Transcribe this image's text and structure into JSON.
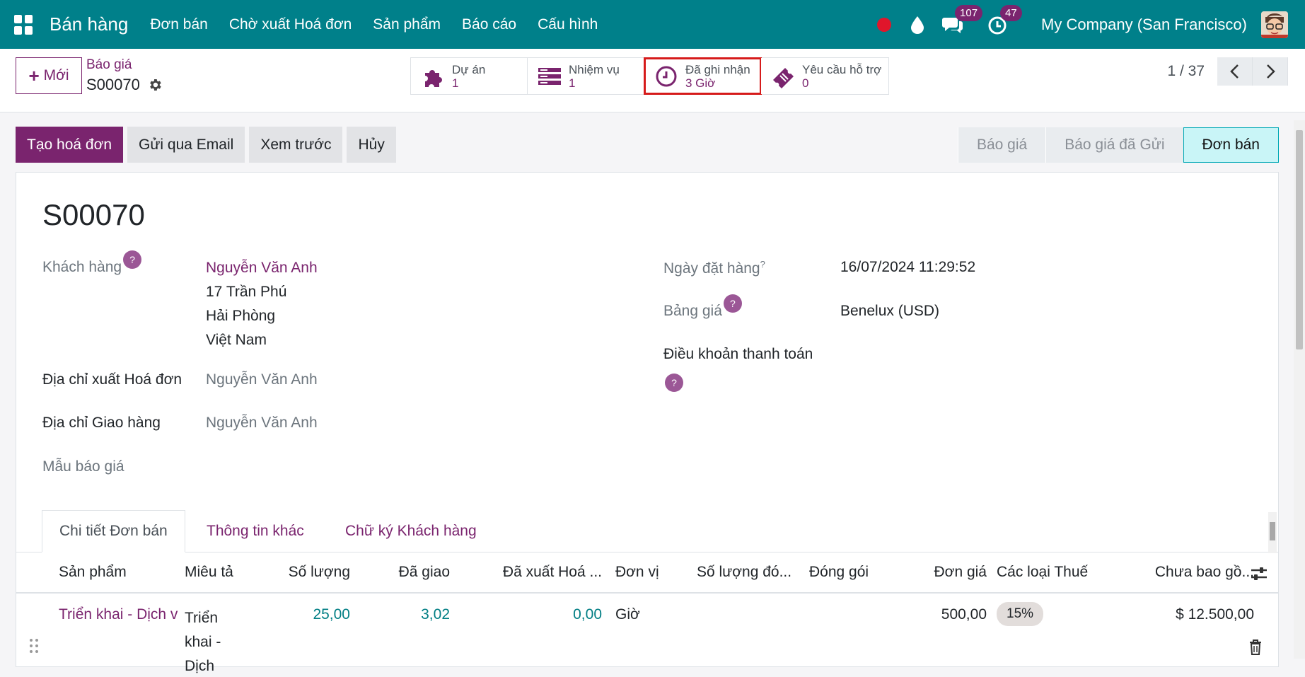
{
  "nav": {
    "brand": "Bán hàng",
    "menu": [
      "Đơn bán",
      "Chờ xuất Hoá đơn",
      "Sản phẩm",
      "Báo cáo",
      "Cấu hình"
    ],
    "messages_count": "107",
    "activities_count": "47",
    "company": "My Company (San Francisco)"
  },
  "control": {
    "new_label": "Mới",
    "breadcrumb_parent": "Báo giá",
    "breadcrumb_current": "S00070",
    "smart_buttons": [
      {
        "label": "Dự án",
        "value": "1"
      },
      {
        "label": "Nhiệm vụ",
        "value": "1"
      },
      {
        "label": "Đã ghi nhận",
        "value": "3 Giờ"
      },
      {
        "label": "Yêu cầu hỗ trợ",
        "value": "0"
      }
    ],
    "pager": "1 / 37"
  },
  "actions": [
    "Tạo hoá đơn",
    "Gửi qua Email",
    "Xem trước",
    "Hủy"
  ],
  "stages": [
    "Báo giá",
    "Báo giá đã Gửi",
    "Đơn bán"
  ],
  "form": {
    "title": "S00070",
    "customer_label": "Khách hàng",
    "customer_name": "Nguyễn Văn Anh",
    "customer_street": "17 Trần Phú",
    "customer_city": "Hải Phòng",
    "customer_country": "Việt Nam",
    "invoice_addr_label": "Địa chỉ xuất Hoá đơn",
    "invoice_addr_value": "Nguyễn Văn Anh",
    "delivery_addr_label": "Địa chỉ Giao hàng",
    "delivery_addr_value": "Nguyễn Văn Anh",
    "template_label": "Mẫu báo giá",
    "order_date_label": "Ngày đặt hàng",
    "order_date_value": "16/07/2024 11:29:52",
    "pricelist_label": "Bảng giá",
    "pricelist_value": "Benelux (USD)",
    "payment_terms_label": "Điều khoản thanh toán",
    "help_mark": "?"
  },
  "tabs": [
    "Chi tiết Đơn bán",
    "Thông tin khác",
    "Chữ ký Khách hàng"
  ],
  "table": {
    "headers": [
      "Sản phẩm",
      "Miêu tả",
      "Số lượng",
      "Đã giao",
      "Đã xuất Hoá ...",
      "Đơn vị",
      "Số lượng đó...",
      "Đóng gói",
      "Đơn giá",
      "Các loại Thuế",
      "Chưa bao gồ..."
    ],
    "row": {
      "product": "Triển khai - Dịch v",
      "description": "Triển khai - Dịch",
      "quantity": "25,00",
      "delivered": "3,02",
      "invoiced": "0,00",
      "uom": "Giờ",
      "unit_price": "500,00",
      "tax": "15%",
      "subtotal": "$ 12.500,00"
    }
  },
  "colors": {
    "nav_bg": "#00808a",
    "primary": "#7a246e",
    "highlight_border": "#d61b1b",
    "active_stage_bg": "#c9f5f7"
  }
}
